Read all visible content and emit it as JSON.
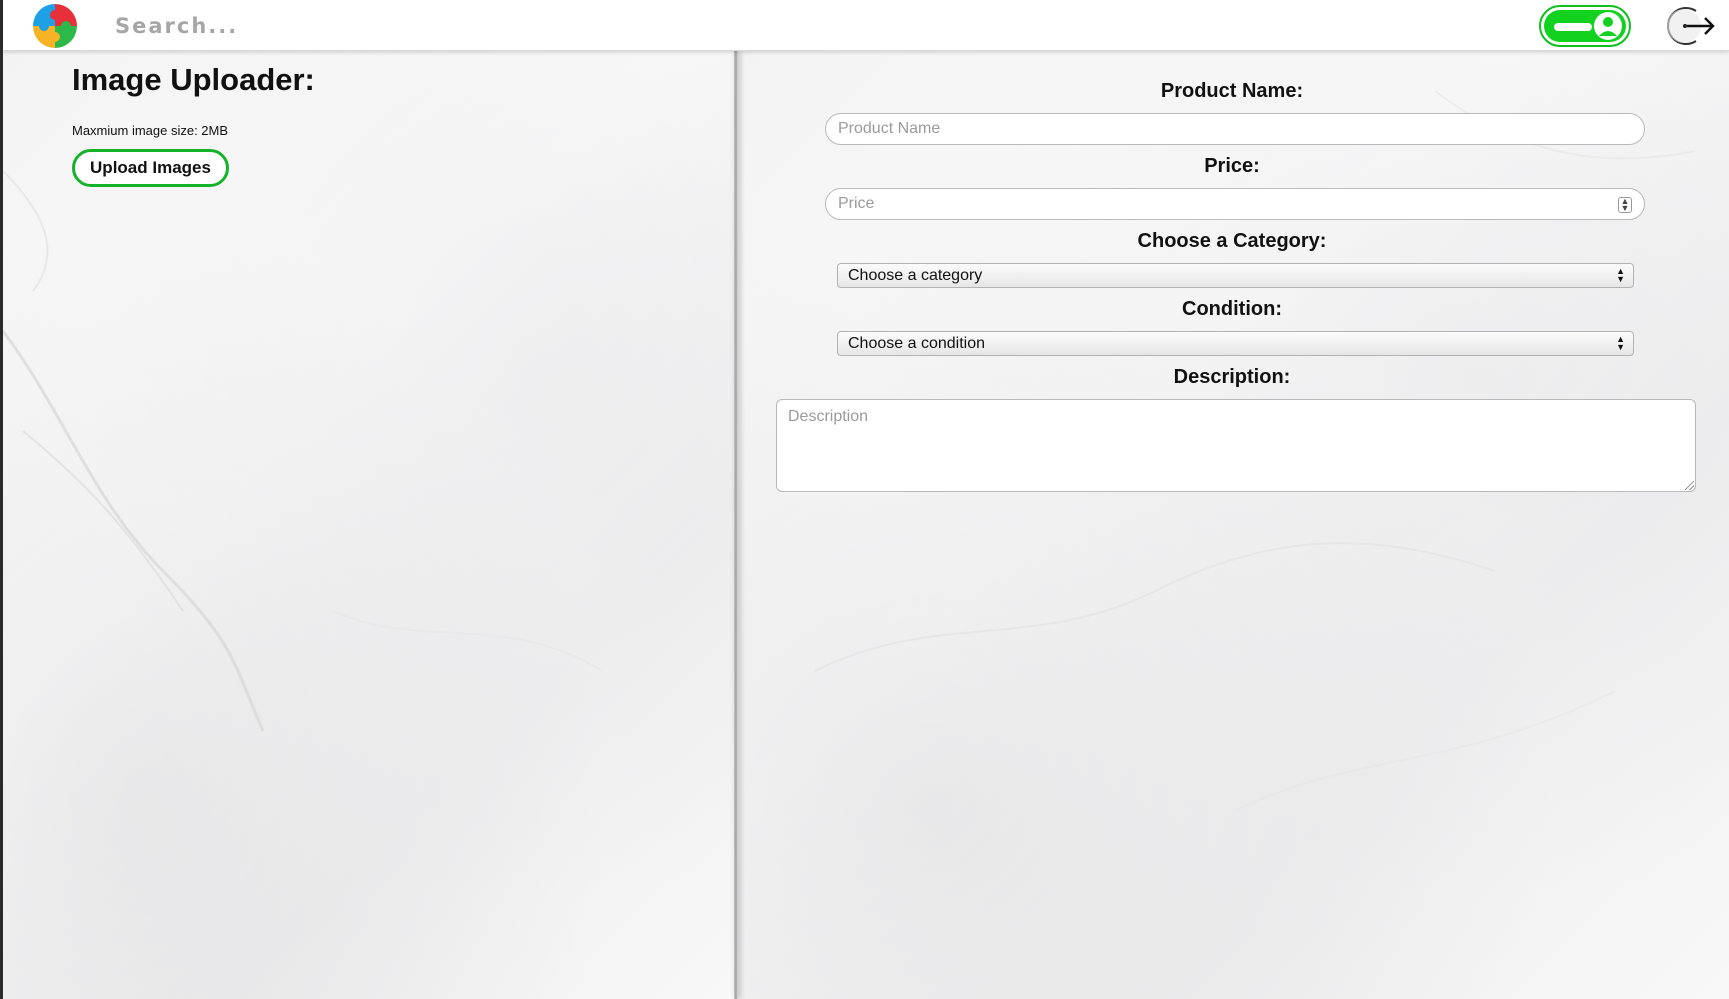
{
  "header": {
    "logo_icon": "puzzle-logo-icon",
    "search_placeholder": "Search...",
    "toggle_state": "on",
    "toggle_color": "#12d21f",
    "logout_icon": "logout-icon"
  },
  "uploader": {
    "title": "Image Uploader:",
    "size_note": "Maxmium image size: 2MB",
    "upload_button": "Upload Images",
    "accent": "#14b32a"
  },
  "form": {
    "product_name_label": "Product Name:",
    "product_name_placeholder": "Product Name",
    "price_label": "Price:",
    "price_placeholder": "Price",
    "category_label": "Choose a Category:",
    "category_selected": "Choose a category",
    "condition_label": "Condition:",
    "condition_selected": "Choose a condition",
    "description_label": "Description:",
    "description_placeholder": "Description"
  }
}
